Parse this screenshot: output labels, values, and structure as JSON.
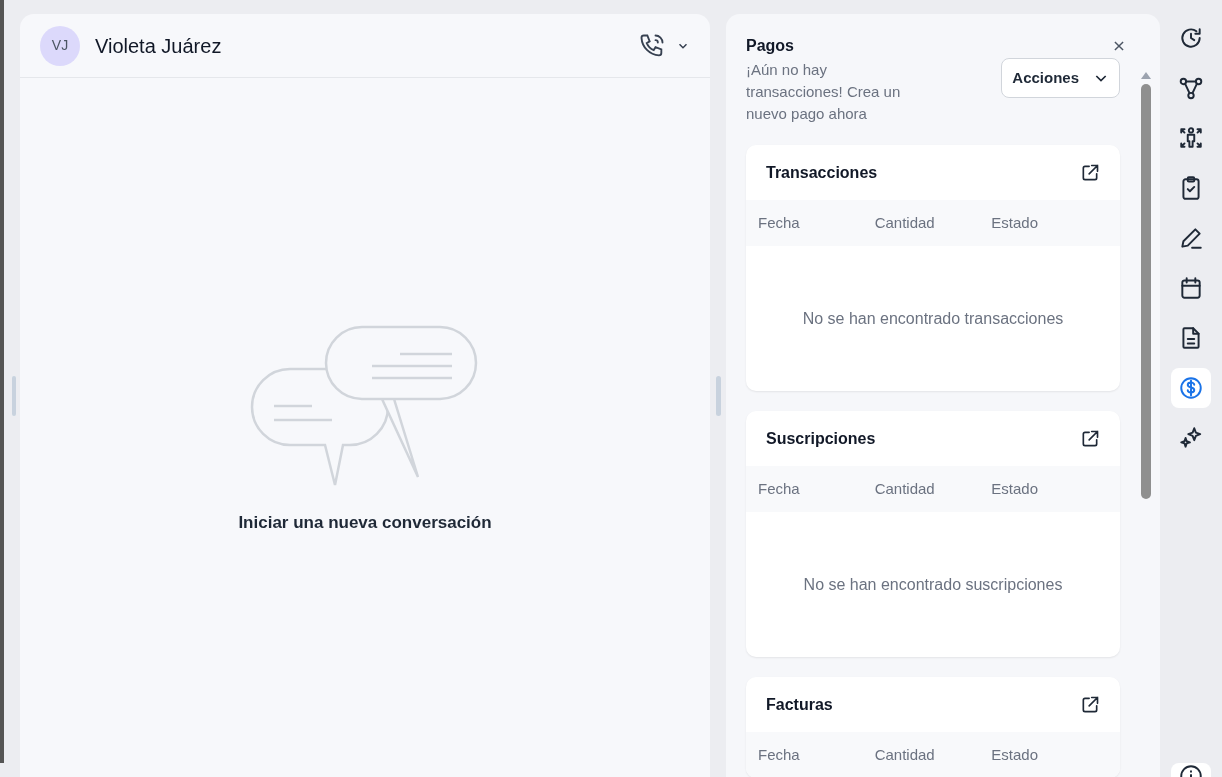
{
  "conversation": {
    "initials": "VJ",
    "name": "Violeta Juárez",
    "empty_message": "Iniciar una nueva conversación"
  },
  "payments": {
    "title": "Pagos",
    "description": "¡Aún no hay transacciones! Crea un nuevo pago ahora",
    "actions_button": "Acciones",
    "sections": [
      {
        "title": "Transacciones",
        "columns": [
          "Fecha",
          "Cantidad",
          "Estado"
        ],
        "empty_message": "No se han encontrado transacciones"
      },
      {
        "title": "Suscripciones",
        "columns": [
          "Fecha",
          "Cantidad",
          "Estado"
        ],
        "empty_message": "No se han encontrado suscripciones"
      },
      {
        "title": "Facturas",
        "columns": [
          "Fecha",
          "Cantidad",
          "Estado"
        ]
      }
    ]
  },
  "rail": [
    {
      "kind": "history",
      "selected": false
    },
    {
      "kind": "workflow",
      "selected": false
    },
    {
      "kind": "people",
      "selected": false
    },
    {
      "kind": "tasks",
      "selected": false
    },
    {
      "kind": "notes",
      "selected": false
    },
    {
      "kind": "calendar",
      "selected": false
    },
    {
      "kind": "document",
      "selected": false
    },
    {
      "kind": "payments",
      "selected": true
    },
    {
      "kind": "ai",
      "selected": false
    },
    {
      "kind": "info",
      "selected": false
    }
  ]
}
